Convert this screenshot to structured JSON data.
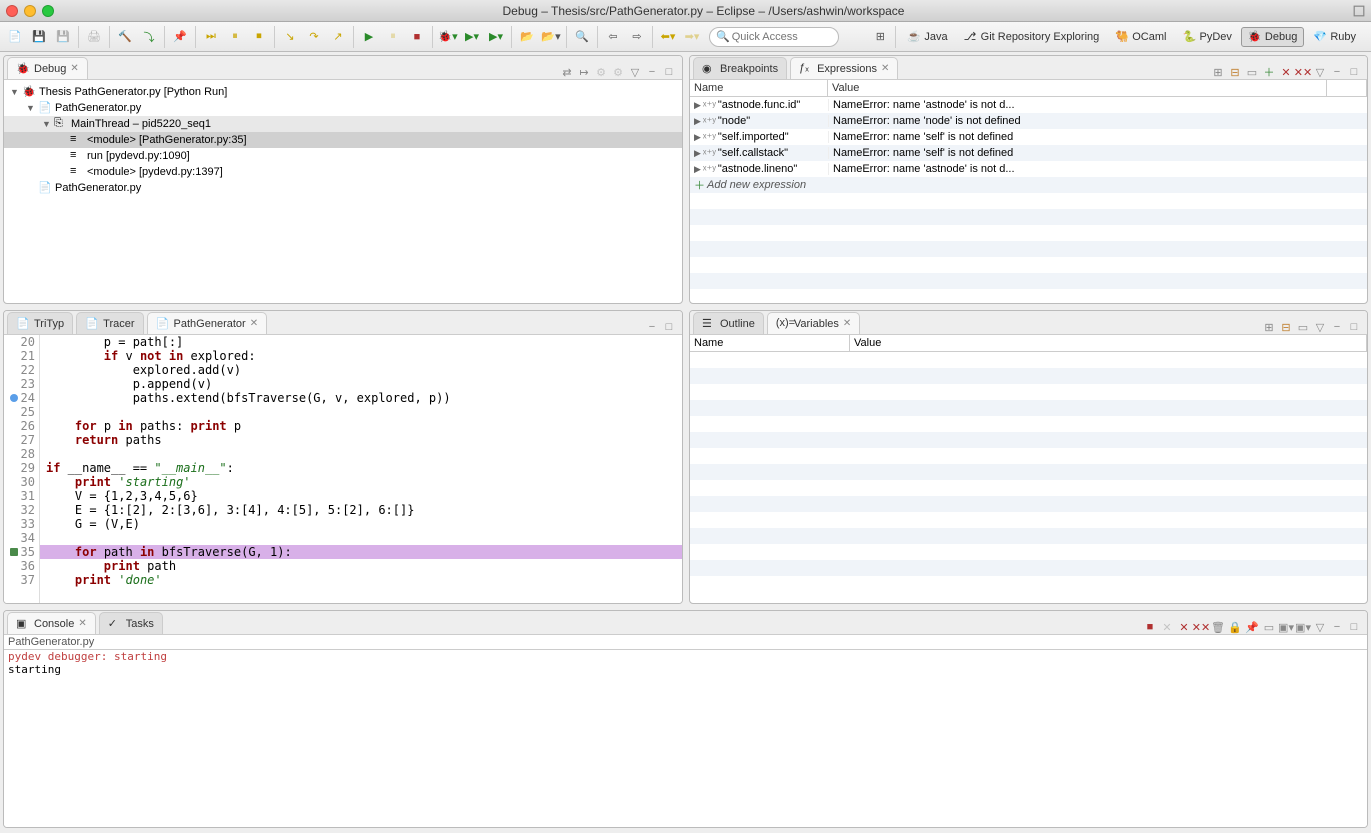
{
  "window": {
    "title": "Debug – Thesis/src/PathGenerator.py – Eclipse – /Users/ashwin/workspace"
  },
  "search": {
    "placeholder": "Quick Access"
  },
  "perspectives": [
    {
      "id": "java",
      "label": "Java"
    },
    {
      "id": "git",
      "label": "Git Repository Exploring"
    },
    {
      "id": "ocaml",
      "label": "OCaml"
    },
    {
      "id": "pydev",
      "label": "PyDev"
    },
    {
      "id": "debug",
      "label": "Debug",
      "active": true
    },
    {
      "id": "ruby",
      "label": "Ruby"
    }
  ],
  "debug": {
    "tab_label": "Debug",
    "tree": [
      {
        "indent": 0,
        "twisty": "▼",
        "icon": "bug",
        "label": "Thesis PathGenerator.py [Python Run]"
      },
      {
        "indent": 1,
        "twisty": "▼",
        "icon": "py",
        "label": "PathGenerator.py"
      },
      {
        "indent": 2,
        "twisty": "▼",
        "icon": "thread",
        "label": "MainThread – pid5220_seq1",
        "highlight": true
      },
      {
        "indent": 3,
        "twisty": "",
        "icon": "stack",
        "label": "<module> [PathGenerator.py:35]",
        "selected": true
      },
      {
        "indent": 3,
        "twisty": "",
        "icon": "stack",
        "label": "run [pydevd.py:1090]"
      },
      {
        "indent": 3,
        "twisty": "",
        "icon": "stack",
        "label": "<module> [pydevd.py:1397]"
      },
      {
        "indent": 1,
        "twisty": "",
        "icon": "file",
        "label": "PathGenerator.py"
      }
    ]
  },
  "breakpoints_tab": "Breakpoints",
  "expressions": {
    "tab_label": "Expressions",
    "columns": {
      "name": "Name",
      "value": "Value"
    },
    "rows": [
      {
        "name": "\"astnode.func.id\"",
        "value": "NameError: name 'astnode' is not d..."
      },
      {
        "name": "\"node\"",
        "value": "NameError: name 'node' is not defined"
      },
      {
        "name": "\"self.imported\"",
        "value": "NameError: name 'self' is not defined"
      },
      {
        "name": "\"self.callstack\"",
        "value": "NameError: name 'self' is not defined"
      },
      {
        "name": "\"astnode.lineno\"",
        "value": "NameError: name 'astnode' is not d..."
      }
    ],
    "add_label": "Add new expression"
  },
  "editor": {
    "tabs": [
      {
        "label": "TriTyp",
        "active": false
      },
      {
        "label": "Tracer",
        "active": false
      },
      {
        "label": "PathGenerator",
        "active": true
      }
    ],
    "first_line": 20,
    "lines": [
      {
        "n": 20,
        "text": "        p = path[:]"
      },
      {
        "n": 21,
        "text": "        if v not in explored:",
        "kw": [
          "if",
          "not",
          "in"
        ]
      },
      {
        "n": 22,
        "text": "            explored.add(v)"
      },
      {
        "n": 23,
        "text": "            p.append(v)"
      },
      {
        "n": 24,
        "text": "            paths.extend(bfsTraverse(G, v, explored, p))",
        "mark": "bp"
      },
      {
        "n": 25,
        "text": ""
      },
      {
        "n": 26,
        "text": "    for p in paths: print p",
        "kw": [
          "for",
          "in",
          "print"
        ]
      },
      {
        "n": 27,
        "text": "    return paths",
        "kw": [
          "return"
        ]
      },
      {
        "n": 28,
        "text": ""
      },
      {
        "n": 29,
        "text": "if __name__ == \"__main__\":",
        "kw": [
          "if"
        ],
        "str": "\"__main__\""
      },
      {
        "n": 30,
        "text": "    print 'starting'",
        "kw": [
          "print"
        ],
        "str": "'starting'"
      },
      {
        "n": 31,
        "text": "    V = {1,2,3,4,5,6}"
      },
      {
        "n": 32,
        "text": "    E = {1:[2], 2:[3,6], 3:[4], 4:[5], 5:[2], 6:[]}"
      },
      {
        "n": 33,
        "text": "    G = (V,E)"
      },
      {
        "n": 34,
        "text": ""
      },
      {
        "n": 35,
        "text": "    for path in bfsTraverse(G, 1):",
        "kw": [
          "for",
          "in"
        ],
        "current": true,
        "mark": "arrow"
      },
      {
        "n": 36,
        "text": "        print path",
        "kw": [
          "print"
        ]
      },
      {
        "n": 37,
        "text": "    print 'done'",
        "kw": [
          "print"
        ],
        "str": "'done'"
      }
    ]
  },
  "outline_tab": "Outline",
  "variables": {
    "tab_label": "Variables",
    "columns": {
      "name": "Name",
      "value": "Value"
    }
  },
  "console": {
    "tab_label": "Console",
    "tasks_tab": "Tasks",
    "header": "PathGenerator.py",
    "lines": [
      {
        "text": "pydev debugger: starting",
        "cls": "red"
      },
      {
        "text": "starting"
      }
    ]
  }
}
